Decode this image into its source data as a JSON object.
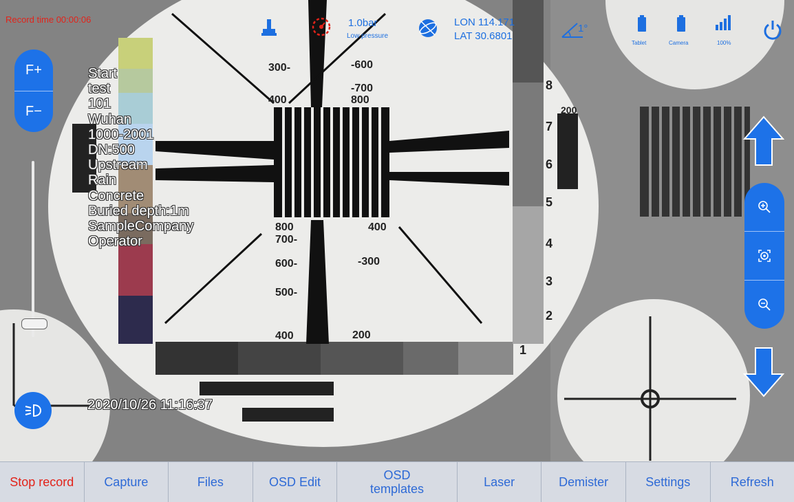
{
  "record_time": "Record time 00:00:06",
  "status": {
    "pressure_value": "1.0bar",
    "pressure_label": "Low pressure",
    "lon": "LON 114.171",
    "lat": "LAT 30.6801",
    "tilt": "1°",
    "tablet_label": "Tablet",
    "camera_label": "Camera",
    "signal_label": "100%"
  },
  "focus": {
    "plus_label": "F+",
    "minus_label": "F−",
    "level": 0.08
  },
  "osd_lines": [
    "Start",
    "test",
    "101",
    "Wuhan",
    "1000-2001",
    "DN:500",
    "Upstream",
    "Rain",
    "Concrete",
    "Buried depth:1m",
    "SampleCompany",
    "Operator"
  ],
  "timestamp": "2020/10/26 11:16:37",
  "bottom_tabs": [
    {
      "label": "Stop record",
      "active": true
    },
    {
      "label": "Capture",
      "active": false
    },
    {
      "label": "Files",
      "active": false
    },
    {
      "label": "OSD Edit",
      "active": false
    },
    {
      "label": "OSD templates",
      "active": false
    },
    {
      "label": "Laser",
      "active": false
    },
    {
      "label": "Demister",
      "active": false
    },
    {
      "label": "Settings",
      "active": false
    },
    {
      "label": "Refresh",
      "active": false
    }
  ],
  "colors": {
    "accent": "#1d72e8",
    "record": "#e2231a",
    "tab_text": "#2e6ad6"
  }
}
